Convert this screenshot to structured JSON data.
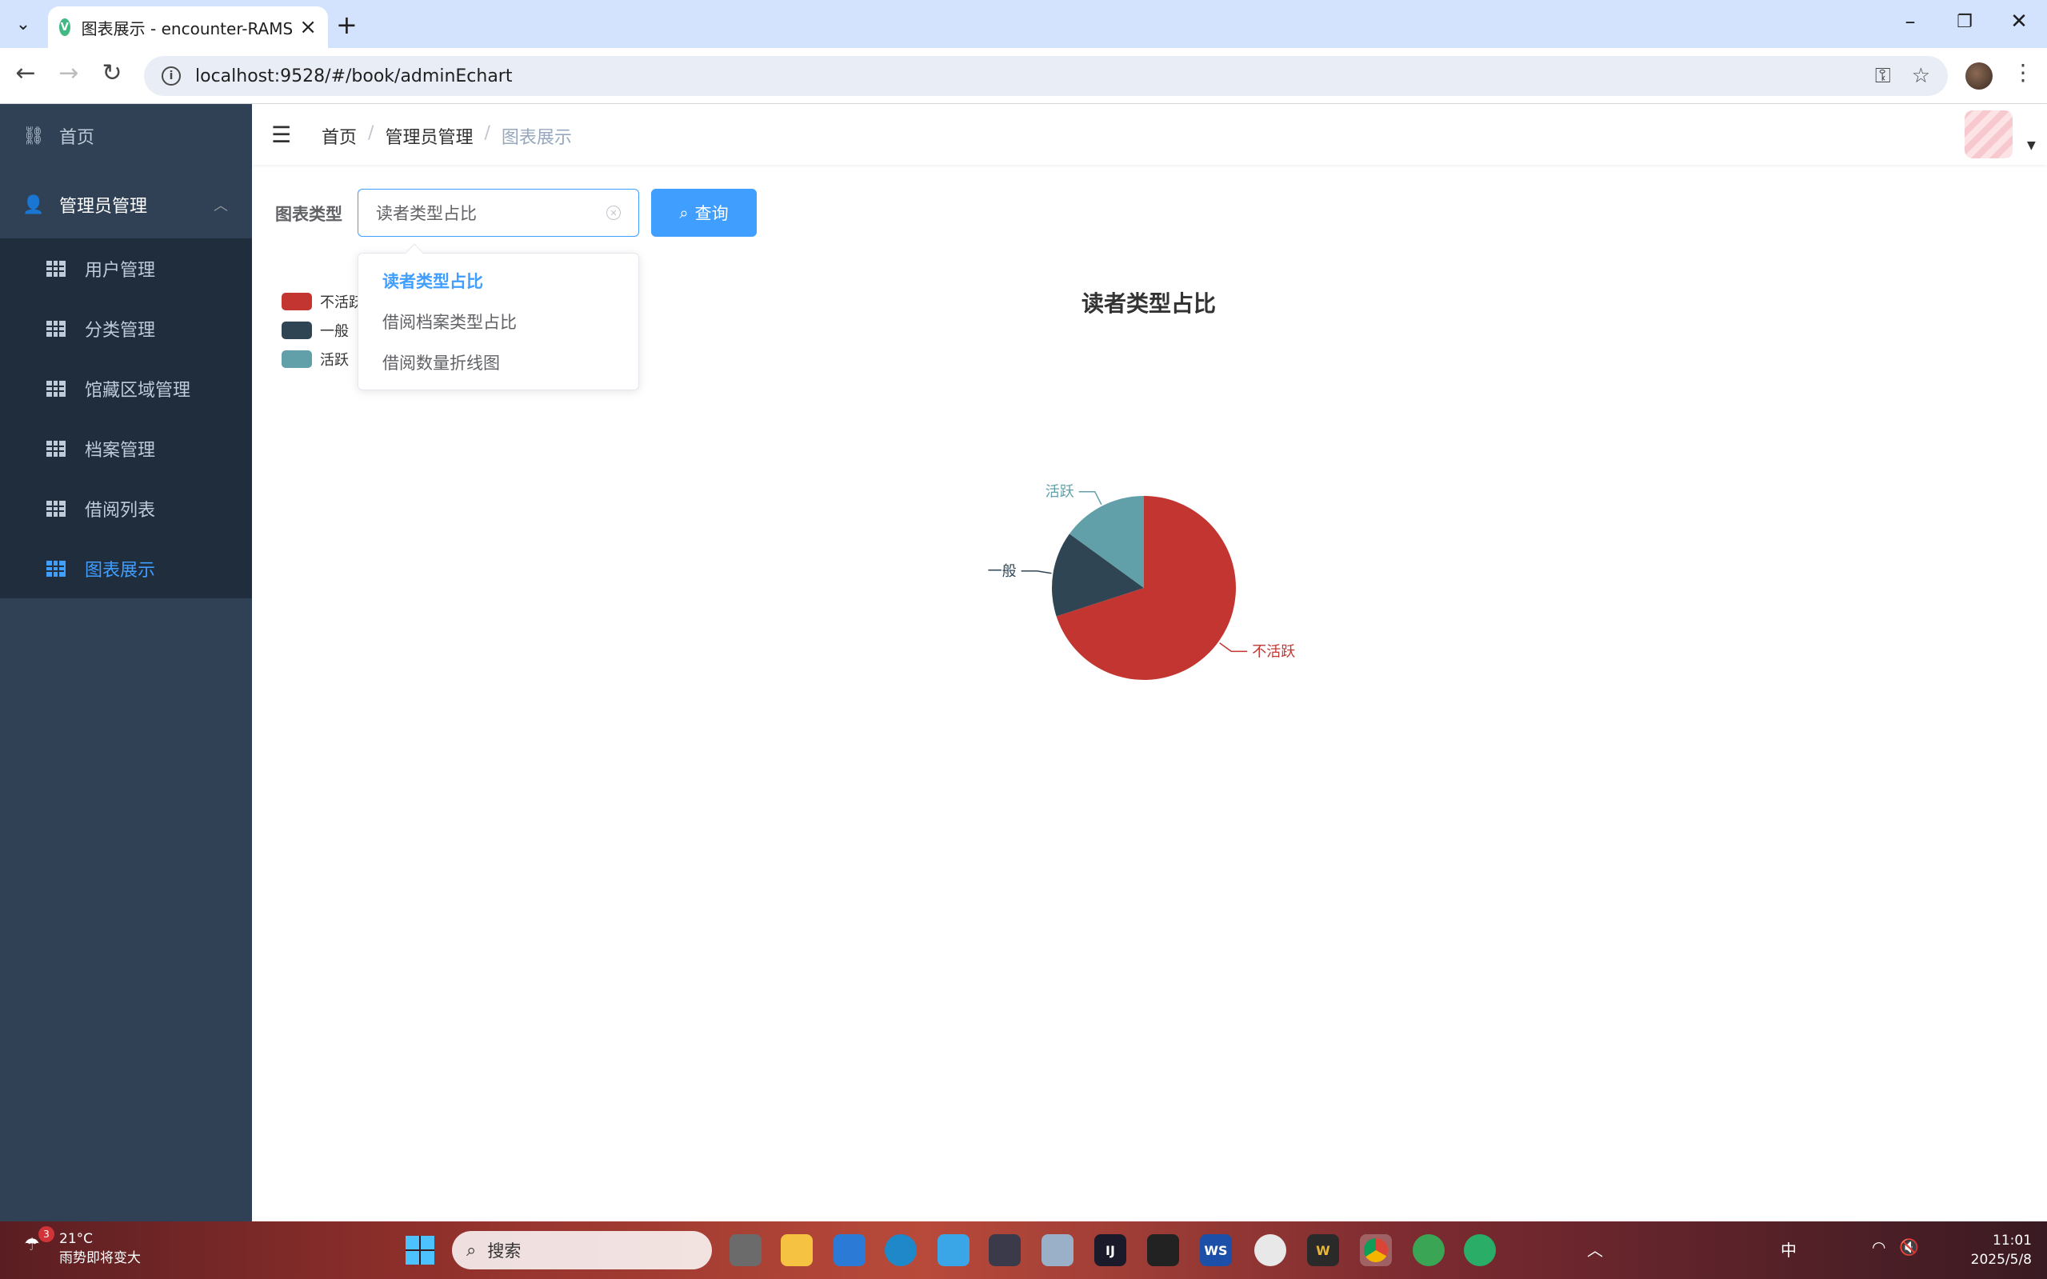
{
  "browser": {
    "tab_title": "图表展示 - encounter-RAMS",
    "url": "localhost:9528/#/book/adminEchart"
  },
  "sidebar": {
    "home": "首页",
    "admin_group": "管理员管理",
    "items": [
      {
        "label": "用户管理"
      },
      {
        "label": "分类管理"
      },
      {
        "label": "馆藏区域管理"
      },
      {
        "label": "档案管理"
      },
      {
        "label": "借阅列表"
      },
      {
        "label": "图表展示",
        "active": true
      }
    ]
  },
  "breadcrumb": [
    "首页",
    "管理员管理",
    "图表展示"
  ],
  "form": {
    "label": "图表类型",
    "selected_value": "读者类型占比",
    "query_button": "查询",
    "options": [
      "读者类型占比",
      "借阅档案类型占比",
      "借阅数量折线图"
    ]
  },
  "chart_data": {
    "type": "pie",
    "title": "读者类型占比",
    "legend_placement": "top-left",
    "slices": [
      {
        "name": "不活跃",
        "value": 70,
        "color": "#c23531"
      },
      {
        "name": "一般",
        "value": 15,
        "color": "#2f4554"
      },
      {
        "name": "活跃",
        "value": 15,
        "color": "#61a0a8"
      }
    ]
  },
  "taskbar": {
    "weather_temp": "21°C",
    "weather_desc": "雨势即将变大",
    "weather_badge": "3",
    "search_placeholder": "搜索",
    "ime": "中",
    "time": "11:01",
    "date": "2025/5/8"
  },
  "colors": {
    "accent": "#409eff",
    "sidebar_bg": "#304156",
    "submenu_bg": "#1f2d3d"
  }
}
